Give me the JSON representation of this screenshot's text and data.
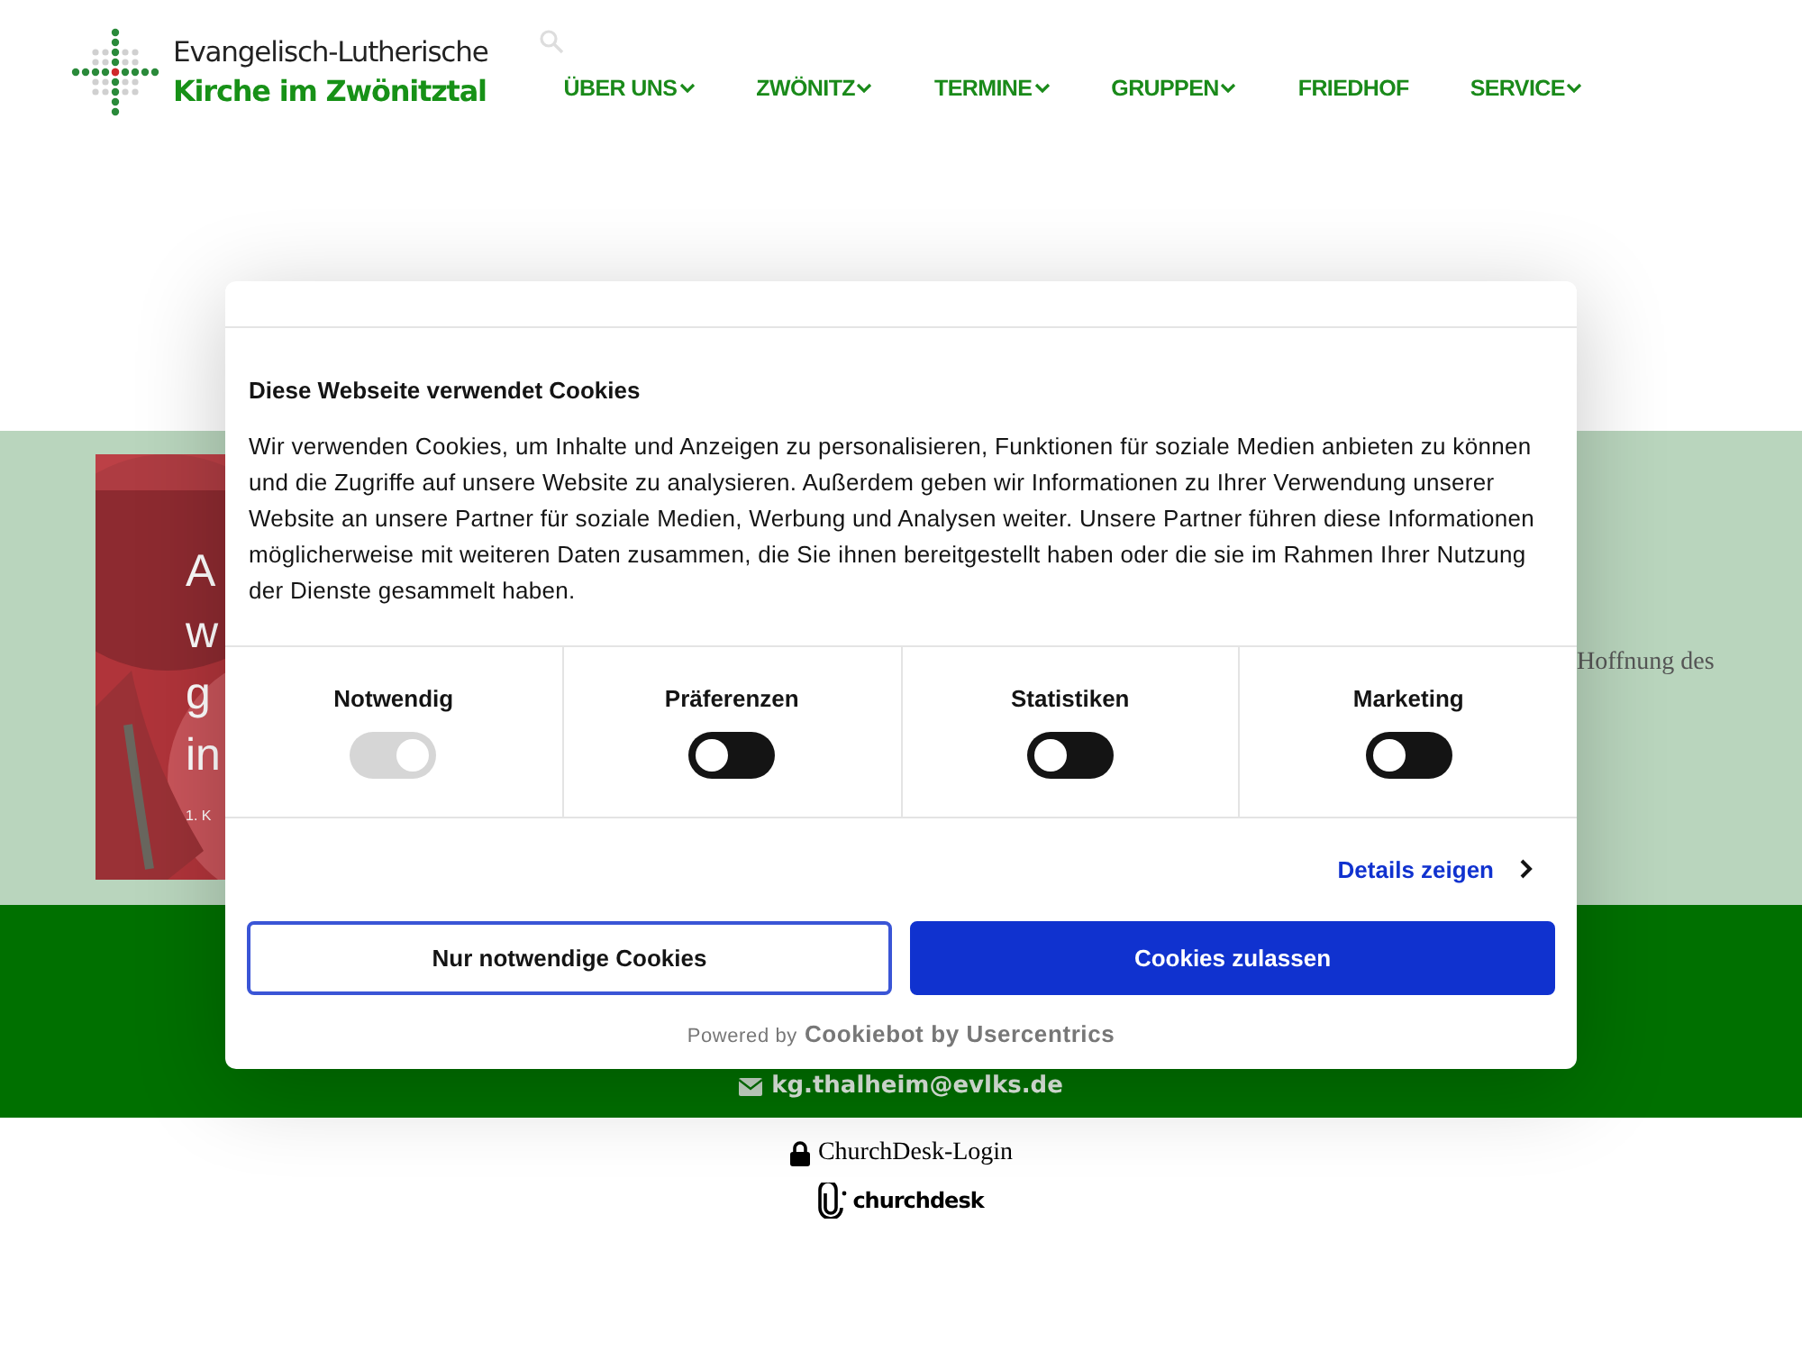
{
  "header": {
    "logo": {
      "line1": "Evangelisch-Lutherische",
      "line2": "Kirche im Zwönitztal"
    },
    "nav": [
      {
        "label": "ÜBER UNS",
        "dropdown": true
      },
      {
        "label": "ZWÖNITZ",
        "dropdown": true
      },
      {
        "label": "TERMINE",
        "dropdown": true
      },
      {
        "label": "GRUPPEN",
        "dropdown": true
      },
      {
        "label": "FRIEDHOF",
        "dropdown": false
      },
      {
        "label": "SERVICE",
        "dropdown": true
      }
    ]
  },
  "banner": {
    "slide_lines": [
      "A",
      "w",
      "g",
      "in"
    ],
    "slide_caption": "1. K",
    "text": "Hoffnung des"
  },
  "footer": {
    "email": "kg.thalheim@evlks.de",
    "login": "ChurchDesk-Login",
    "brand": "churchdesk"
  },
  "cookie_dialog": {
    "title": "Diese Webseite verwendet Cookies",
    "body": "Wir verwenden Cookies, um Inhalte und Anzeigen zu personalisieren, Funktionen für soziale Medien anbieten zu können und die Zugriffe auf unsere Website zu analysieren. Außerdem geben wir Informationen zu Ihrer Verwendung unserer Website an unsere Partner für soziale Medien, Werbung und Analysen weiter. Unsere Partner führen diese Informationen möglicherweise mit weiteren Daten zusammen, die Sie ihnen bereitgestellt haben oder die sie im Rahmen Ihrer Nutzung der Dienste gesammelt haben.",
    "categories": [
      {
        "label": "Notwendig",
        "checked": true,
        "disabled": true
      },
      {
        "label": "Präferenzen",
        "checked": false,
        "disabled": false
      },
      {
        "label": "Statistiken",
        "checked": false,
        "disabled": false
      },
      {
        "label": "Marketing",
        "checked": false,
        "disabled": false
      }
    ],
    "details_link": "Details zeigen",
    "buttons": [
      {
        "label": "Nur notwendige Cookies",
        "kind": "secondary"
      },
      {
        "label": "Cookies zulassen",
        "kind": "primary"
      }
    ],
    "powered_by": "Powered by",
    "powered_brand": "Cookiebot by Usercentrics"
  }
}
